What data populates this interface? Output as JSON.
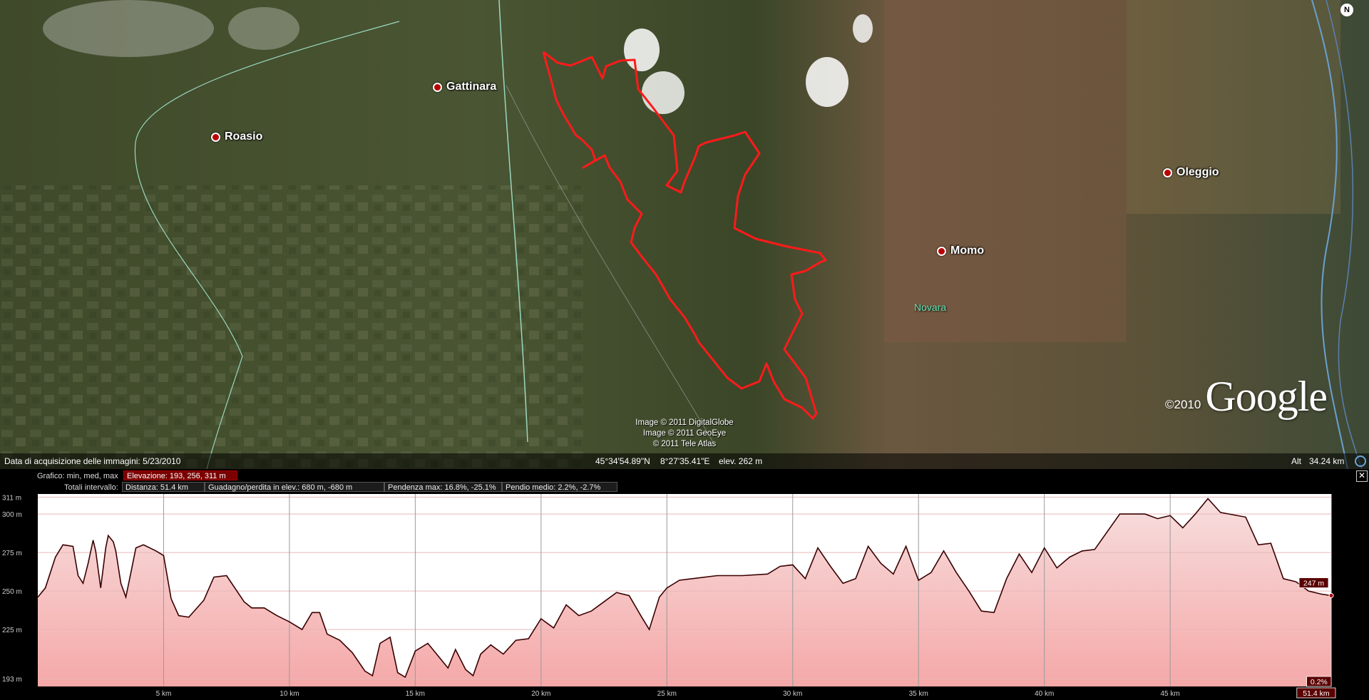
{
  "map": {
    "places": [
      {
        "name": "Gattinara"
      },
      {
        "name": "Roasio"
      },
      {
        "name": "Oleggio"
      },
      {
        "name": "Momo"
      }
    ],
    "region_label": "Novara",
    "compass": "N",
    "credits": [
      "Image © 2011 DigitalGlobe",
      "Image © 2011 GeoEye",
      "© 2011 Tele Atlas"
    ],
    "logo_copyright": "©2010",
    "logo_word": "Google",
    "route_color": "#ff1a1a"
  },
  "status": {
    "acquisition": "Data di acquisizione delle immagini: 5/23/2010",
    "lat": "45°34'54.89\"N",
    "lon": "8°27'35.41\"E",
    "elev": "elev. 262 m",
    "alt_label": "Alt",
    "alt_value": "34.24 km"
  },
  "profile": {
    "row1_label": "Grafico: min, med, max",
    "elevation_field": "Elevazione: 193, 256, 311 m",
    "row2_label": "Totali intervallo:",
    "distance_field": "Distanza: 51.4 km",
    "gain_field": "Guadagno/perdita in elev.: 680 m, -680 m",
    "slope_max_field": "Pendenza max: 16.8%, -25.1%",
    "slope_avg_field": "Pendio medio: 2.2%, -2.7%",
    "close_label": "✕",
    "cursor_value_label": "247 m",
    "slope_label": "0.2%",
    "end_label": "51.4 km"
  },
  "chart_data": {
    "type": "area",
    "x_unit": "km",
    "y_unit": "m",
    "xlim": [
      0,
      51.4
    ],
    "ylim": [
      188,
      313
    ],
    "xticks": [
      5,
      10,
      15,
      20,
      25,
      30,
      35,
      40,
      45
    ],
    "xtick_labels": [
      "5 km",
      "10 km",
      "15 km",
      "20 km",
      "25 km",
      "30 km",
      "35 km",
      "40 km",
      "45 km"
    ],
    "yticks": [
      193,
      225,
      250,
      275,
      300,
      311
    ],
    "ytick_labels": [
      "193 m",
      "225 m",
      "250 m",
      "275 m",
      "300 m",
      "311 m"
    ],
    "series": [
      {
        "x": [
          0,
          0.3,
          0.7,
          1.0,
          1.4,
          1.6,
          1.8,
          2.0,
          2.2,
          2.3,
          2.5,
          2.7,
          2.8,
          3.0,
          3.1,
          3.3,
          3.5,
          3.7,
          3.9,
          4.2,
          4.7,
          5.0,
          5.3,
          5.6,
          6.0,
          6.6,
          7.0,
          7.5,
          8.2,
          8.5,
          9.0,
          9.5,
          10.0,
          10.5,
          10.9,
          11.2,
          11.5,
          12.0,
          12.5,
          13.0,
          13.3,
          13.6,
          14.0,
          14.3,
          14.6,
          15.0,
          15.5,
          16.0,
          16.3,
          16.6,
          17.0,
          17.3,
          17.6,
          18.0,
          18.5,
          19.0,
          19.5,
          20.0,
          20.5,
          21.0,
          21.5,
          22.0,
          22.5,
          23.0,
          23.5,
          24.0,
          24.3,
          24.7,
          25.0,
          25.5,
          26.0,
          27.0,
          28.0,
          29.0,
          29.5,
          30.0,
          30.5,
          31.0,
          31.5,
          32.0,
          32.5,
          33.0,
          33.5,
          34.0,
          34.5,
          35.0,
          35.5,
          36.0,
          36.5,
          37.0,
          37.5,
          38.0,
          38.5,
          39.0,
          39.5,
          40.0,
          40.5,
          41.0,
          41.5,
          42.0,
          43.0,
          44.0,
          44.5,
          45.0,
          45.5,
          46.0,
          46.5,
          47.0,
          48.0,
          48.5,
          49.0,
          49.5,
          50.0,
          50.5,
          51.0,
          51.4
        ],
        "y": [
          246,
          252,
          272,
          280,
          279,
          260,
          255,
          268,
          283,
          276,
          252,
          278,
          286,
          282,
          276,
          255,
          246,
          262,
          278,
          280,
          276,
          273,
          245,
          234,
          233,
          244,
          259,
          260,
          243,
          239,
          239,
          234,
          230,
          225,
          236,
          236,
          222,
          218,
          210,
          198,
          195,
          216,
          220,
          197,
          194,
          211,
          216,
          206,
          200,
          212,
          199,
          195,
          209,
          215,
          209,
          218,
          219,
          232,
          226,
          241,
          234,
          237,
          243,
          249,
          247,
          233,
          225,
          246,
          252,
          257,
          258,
          260,
          260,
          261,
          266,
          267,
          258,
          278,
          266,
          255,
          258,
          279,
          268,
          261,
          279,
          257,
          262,
          276,
          262,
          250,
          237,
          236,
          258,
          274,
          262,
          278,
          265,
          272,
          276,
          277,
          300,
          300,
          297,
          299,
          291,
          300,
          310,
          301,
          298,
          280,
          281,
          258,
          256,
          250,
          248,
          247
        ]
      }
    ],
    "cursor_x": 51.4,
    "cursor_y": 247
  }
}
